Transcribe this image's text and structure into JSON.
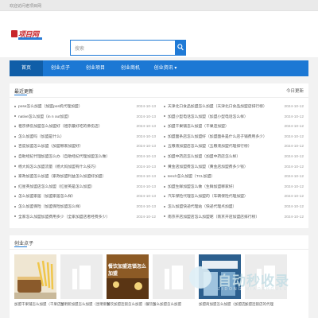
{
  "topbar": {
    "welcome": "欢迎访问老项目网"
  },
  "logo": {
    "text": "项目网"
  },
  "search": {
    "placeholder": "搜索"
  },
  "nav": {
    "items": [
      {
        "label": "首页"
      },
      {
        "label": "创业点子"
      },
      {
        "label": "创业项目"
      },
      {
        "label": "创业商机"
      },
      {
        "label": "创业资讯 ▾"
      }
    ]
  },
  "news": {
    "title": "最近更新",
    "right_label": "今日更新",
    "left": [
      {
        "text": "pose怎么加盟（加盟pos机代理加盟）",
        "date": "2024-10-13"
      },
      {
        "text": "native怎么加盟（in n out加盟）",
        "date": "2024-10-13"
      },
      {
        "text": "祖宗佛伤加盟怎么加盟好（祖宗最好吃的佛伤店）",
        "date": "2024-10-13"
      },
      {
        "text": "怎么加盟吗（加盟是什么）",
        "date": "2024-10-13"
      },
      {
        "text": "百度加盟怎么加盟（加盟哪家加盟好）",
        "date": "2024-10-13"
      },
      {
        "text": "自助经纪代理加盟怎么办（自助经纪代理加盟怎么做）",
        "date": "2024-10-13"
      },
      {
        "text": "杨大妈怎么加盟流量（杨大妈加盟有什么技巧）",
        "date": "2024-10-13"
      },
      {
        "text": "家政加盟怎么加盟（家政加盟利益怎么加盟好加盟）",
        "date": "2024-10-13"
      },
      {
        "text": "红星英加盟店怎么加盟（红星英是怎么加盟）",
        "date": "2024-10-13"
      },
      {
        "text": "怎么加盟家居（加盟家居怎么样）",
        "date": "2024-10-13"
      },
      {
        "text": "怎么加盟保险（加盟保险加盟怎么样）",
        "date": "2024-10-13"
      },
      {
        "text": "全家怎么加盟加盟费用多少（全家加盟店者经费多少）",
        "date": "2024-10-12"
      }
    ],
    "right": [
      {
        "text": "天津北口食品加盟怎么加盟（天津北口食品加盟店排行榜）",
        "date": "2024-10-12"
      },
      {
        "text": "加盟小型电话怎么加盟（加盟小型电话怎么样）",
        "date": "2024-10-12"
      },
      {
        "text": "加盟干果铺怎么加盟（干果店加盟）",
        "date": "2024-10-12"
      },
      {
        "text": "加盟面条店怎么加盟好（加盟面条是什么店子铺费用多少）",
        "date": "2024-10-12"
      },
      {
        "text": "五粮液加盟店怎么加盟（五粮液加盟代理排行榜）",
        "date": "2024-10-12"
      },
      {
        "text": "加盟中药店怎么加盟（加盟中药店怎么样）",
        "date": "2024-10-12"
      },
      {
        "text": "黄金店加盟费怎么加盟（黄金店加盟费多少钱）",
        "date": "2024-10-12"
      },
      {
        "text": "tench怎么加盟（TCL加盟）",
        "date": "2024-10-12"
      },
      {
        "text": "加盟生鲜加盟怎么做（生鲜加盟哪家好）",
        "date": "2024-10-12"
      },
      {
        "text": "汽车保险代理怎么加盟的（车辆保险代理加盟）",
        "date": "2024-10-12"
      },
      {
        "text": "怎么加盟快递代理站（快递代理点加盟）",
        "date": "2024-10-12"
      },
      {
        "text": "南京开店加盟店怎么加盟呢（南京开店加盟店排行榜）",
        "date": "2024-10-12"
      }
    ]
  },
  "startup": {
    "title": "创业点子",
    "items": [
      {
        "caption": "加盟干果铺怎么加盟（干果店加盟）"
      },
      {
        "caption": "昆明新加盟怎么加盟（昆明新加盟）"
      },
      {
        "caption": "餐饮加盟连锁怎么加盟（餐饮加盟连锁）"
      },
      {
        "caption": "怎么加盟怎么加盟"
      },
      {
        "caption": "加盟商加盟怎么加盟（加盟店）"
      },
      {
        "caption": "加盟连锁店的代理"
      }
    ],
    "thumb3_overlay": "餐饮加盟连锁怎么加盟"
  },
  "watermark": {
    "text": "自动秒收录",
    "sub": "ZIDONG MIAOSHOULU"
  },
  "colors": {
    "primary": "#1c78d4",
    "nav_active": "#105ea8",
    "brand_red": "#c8262c"
  }
}
